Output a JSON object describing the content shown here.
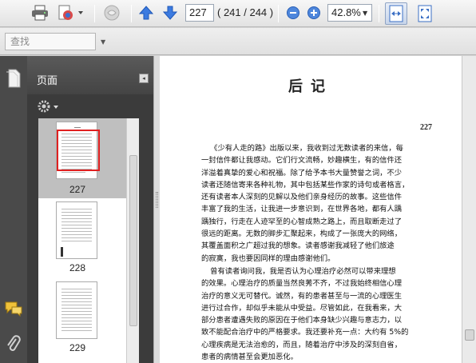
{
  "toolbar": {
    "page_current": "227",
    "page_count": "( 241 / 244 )",
    "zoom": "42.8%"
  },
  "search": {
    "placeholder": "查找"
  },
  "panel": {
    "title": "页面",
    "thumbnails": [
      {
        "label": "227"
      },
      {
        "label": "228"
      },
      {
        "label": "229"
      }
    ]
  },
  "document": {
    "title": "后记",
    "page_number": "227",
    "paragraph1": [
      "《少有人走的路》出版以来，我收到过无数读者的来信，每",
      "一封信件都让我感动。它们行文流畅，妙趣横生，有的信件还",
      "洋溢着真挚的爱心和祝福。除了给予本书大量赞誉之词，不少",
      "读者还随信寄来各种礼物，其中包括某些作家的诗句或者格言，",
      "还有读者本人深刻的见解以及他们亲身经历的故事。这些信件",
      "丰富了我的生活，让我进一步意识到，在世界各地，都有人踽",
      "踽独行，行走在人迹罕至的心智成熟之路上，而且取断走过了",
      "很远的距离。无数的脚步汇聚起来，构成了一张庞大的网络，",
      "其覆盖面积之广超过我的想象。读者感谢我减轻了他们旅途",
      "的寂寞，我也要因同样的理由感谢他们。"
    ],
    "paragraph2": [
      "曾有读者询问我，我是否认为心理治疗必然可以带来理想",
      "的效果。心理治疗的质量当然良莠不齐，不过我始终相信心理",
      "治疗的意义无可替代。诚然，有的患者甚至与一流的心理医生",
      "进行过合作，却似乎未能从中受益。尽管如此，在我看来，大",
      "部分患者遭遇失败的原因在于他们本身缺少兴趣与意志力，以",
      "致不能配合治疗中的严格要求。我还要补充一点：大约有 5%的",
      "心理疾病是无法治愈的，而且，随着治疗中涉及的深刻自省，",
      "患者的病情甚至会更加恶化。"
    ]
  },
  "colors": {
    "selection_border": "#e02020",
    "accent_blue": "#2f6fce"
  }
}
